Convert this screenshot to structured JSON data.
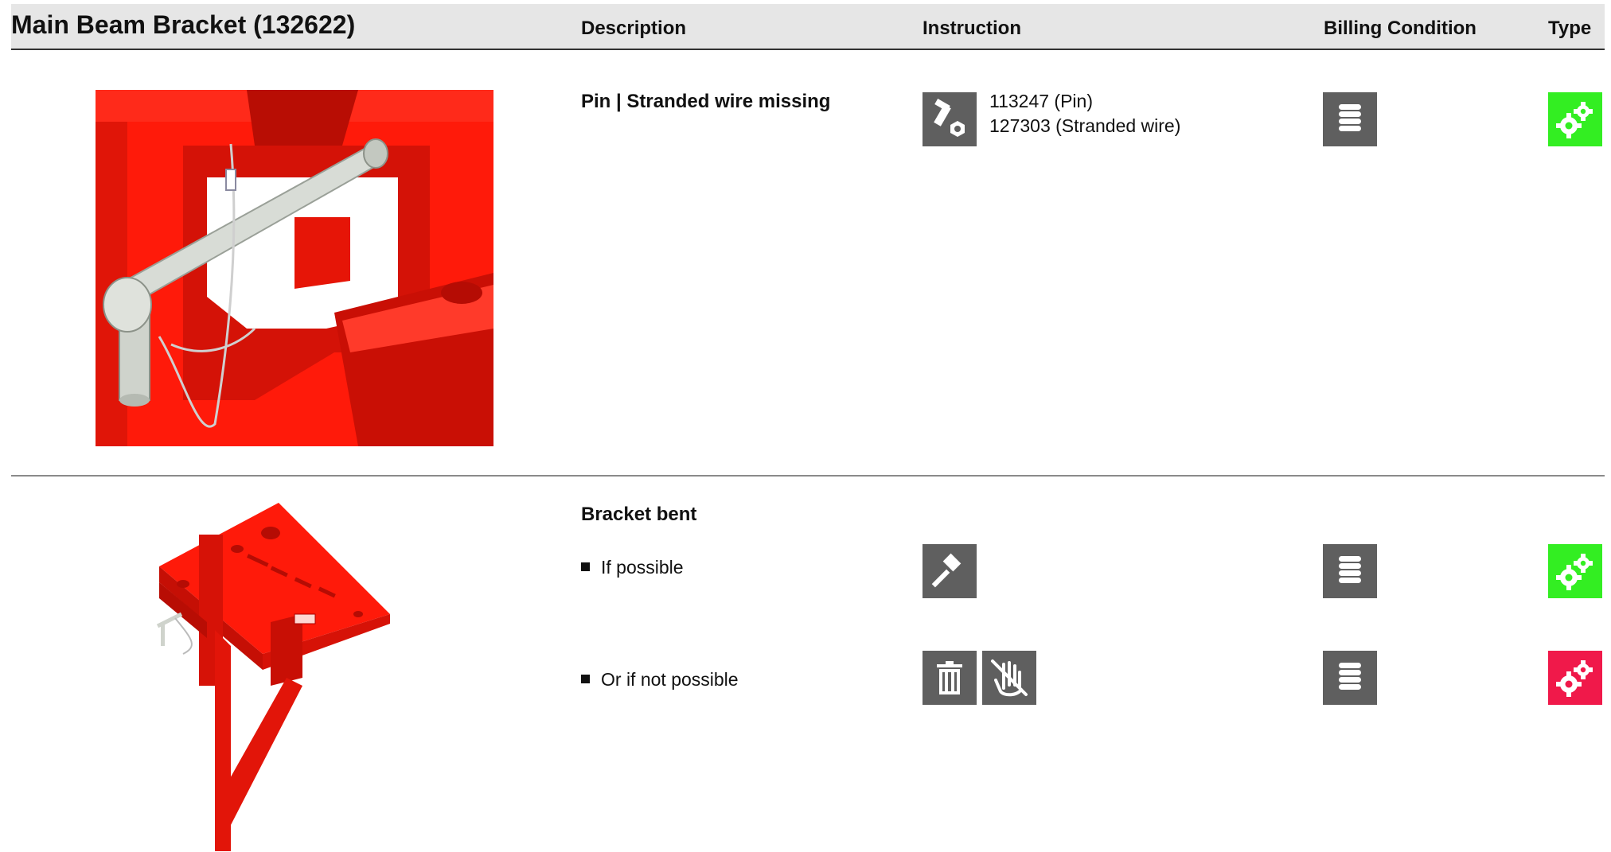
{
  "header": {
    "title": "Main Beam Bracket (132622)",
    "col_description": "Description",
    "col_instruction": "Instruction",
    "col_billing": "Billing Condition",
    "col_type": "Type"
  },
  "rows": [
    {
      "description": "Pin | Stranded wire missing",
      "parts": [
        "113247 (Pin)",
        "127303 (Stranded wire)"
      ],
      "icons": [
        "bolt-nut-icon",
        "coin-stack-icon",
        "gears-icon"
      ],
      "type_color": "#33ee22"
    },
    {
      "description": "Bracket bent",
      "options": [
        {
          "label": "If possible",
          "icons": [
            "hammer-icon",
            "coin-stack-icon",
            "gears-icon"
          ],
          "type_color": "#33ee22"
        },
        {
          "label": "Or if not possible",
          "icons": [
            "trash-icon",
            "no-touch-icon",
            "coin-stack-icon",
            "gears-icon"
          ],
          "type_color": "#f0194a"
        }
      ]
    }
  ],
  "colors": {
    "header_bg": "#e6e6e6",
    "icon_dark": "#5f5f5f",
    "type_ok": "#33ee22",
    "type_scrap": "#f0194a",
    "product_red": "#ff1a0a"
  }
}
